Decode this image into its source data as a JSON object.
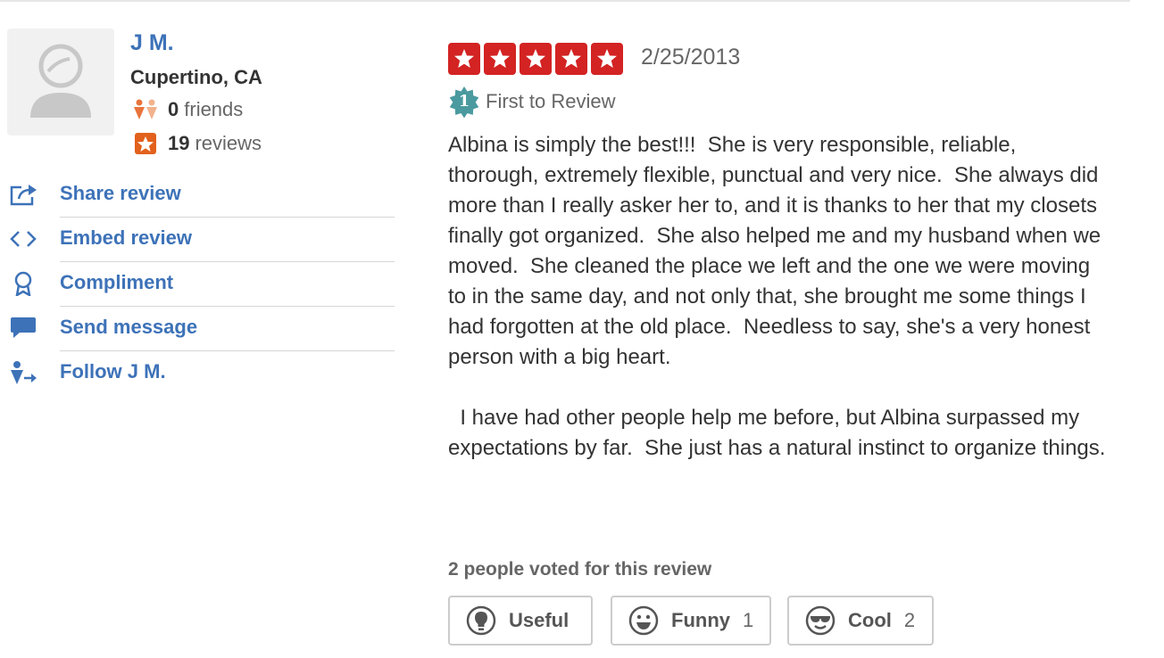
{
  "user": {
    "name": "J M.",
    "location": "Cupertino, CA",
    "friends_count": "0",
    "friends_label": "friends",
    "reviews_count": "19",
    "reviews_label": "reviews"
  },
  "actions": [
    {
      "label": "Share review",
      "icon": "share-icon"
    },
    {
      "label": "Embed review",
      "icon": "embed-code-icon"
    },
    {
      "label": "Compliment",
      "icon": "award-ribbon-icon"
    },
    {
      "label": "Send message",
      "icon": "speech-bubble-icon"
    },
    {
      "label": "Follow J M.",
      "icon": "follow-user-icon"
    }
  ],
  "review": {
    "rating": 5,
    "date": "2/25/2013",
    "first_badge_number": "1",
    "first_to_review": "First to Review",
    "text": "Albina is simply the best!!!  She is very responsible, reliable, thorough, extremely flexible, punctual and very nice.  She always did more than I really asker her to, and it is thanks to her that my closets finally got organized.  She also helped me and my husband when we moved.  She cleaned the place we left and the one we were moving to in the same day, and not only that, she brought me some things I had forgotten at the old place.  Needless to say, she's a very honest person with a big heart.\n\n  I have had other people help me before, but Albina surpassed my expectations by far.  She just has a natural instinct to organize things.",
    "votes_text": "2 people voted for this review"
  },
  "vote_buttons": {
    "useful": {
      "label": "Useful",
      "count": ""
    },
    "funny": {
      "label": "Funny",
      "count": "1"
    },
    "cool": {
      "label": "Cool",
      "count": "2"
    }
  },
  "colors": {
    "link": "#3d72b8",
    "star_red": "#d32323",
    "badge_teal": "#4a9a9f",
    "friends_orange": "#e8743b",
    "reviews_orange": "#e2611c"
  }
}
